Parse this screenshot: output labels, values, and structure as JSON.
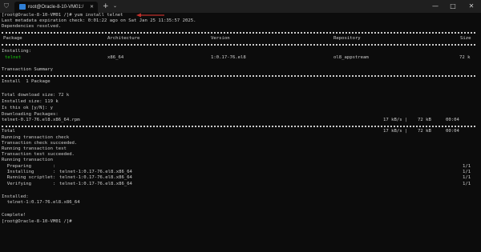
{
  "window": {
    "tab_title": "root@Oracle-8-10-VM01:/",
    "tab_icon": "terminal-icon",
    "shield_icon": "shield-icon",
    "new_tab": "+",
    "dropdown": "⌄",
    "minimize": "—",
    "maximize": "□",
    "close": "✕",
    "tab_close": "✕"
  },
  "terminal": {
    "prompt_cmd": "[root@Oracle-8-10-VM01 /]# yum install telnet",
    "metadata": "Last metadata expiration check: 0:01:22 ago on Sat Jan 25 11:35:57 2025.",
    "deps_resolved": "Dependencies resolved.",
    "table": {
      "headers": {
        "package": "Package",
        "architecture": "Architecture",
        "version": "Version",
        "repository": "Repository",
        "size": "Size"
      },
      "installing_label": "Installing:",
      "rows": [
        {
          "package": "telnet",
          "architecture": "x86_64",
          "version": "1:0.17-76.el8",
          "repository": "ol8_appstream",
          "size": "72 k"
        }
      ]
    },
    "summary_title": "Transaction Summary",
    "install_count": "Install  1 Package",
    "total_download": "Total download size: 72 k",
    "installed_size": "Installed size: 119 k",
    "confirm": "Is this ok [y/N]: y",
    "downloading": "Downloading Packages:",
    "download": {
      "file": "telnet-0.17-76.el8.x86_64.rpm",
      "speed": "17 kB/s |",
      "size": "72 kB",
      "time": "00:04"
    },
    "total": {
      "label": "Total",
      "speed": "17 kB/s |",
      "size": "72 kB",
      "time": "00:04"
    },
    "transaction_lines": [
      "Running transaction check",
      "Transaction check succeeded.",
      "Running transaction test",
      "Transaction test succeeded.",
      "Running transaction"
    ],
    "steps": [
      {
        "label": "  Preparing        :",
        "pkg": "",
        "count": "1/1"
      },
      {
        "label": "  Installing       :",
        "pkg": "telnet-1:0.17-76.el8.x86_64",
        "count": "1/1"
      },
      {
        "label": "  Running scriptlet:",
        "pkg": "telnet-1:0.17-76.el8.x86_64",
        "count": "1/1"
      },
      {
        "label": "  Verifying        :",
        "pkg": "telnet-1:0.17-76.el8.x86_64",
        "count": "1/1"
      }
    ],
    "installed_label": "Installed:",
    "installed_pkg": "  telnet-1:0.17-76.el8.x86_64",
    "complete": "Complete!",
    "final_prompt": "[root@Oracle-8-10-VM01 /]# "
  },
  "colors": {
    "background": "#0c0c0c",
    "text": "#cccccc",
    "green": "#16c60c",
    "annotation_arrow": "#c0302b"
  }
}
